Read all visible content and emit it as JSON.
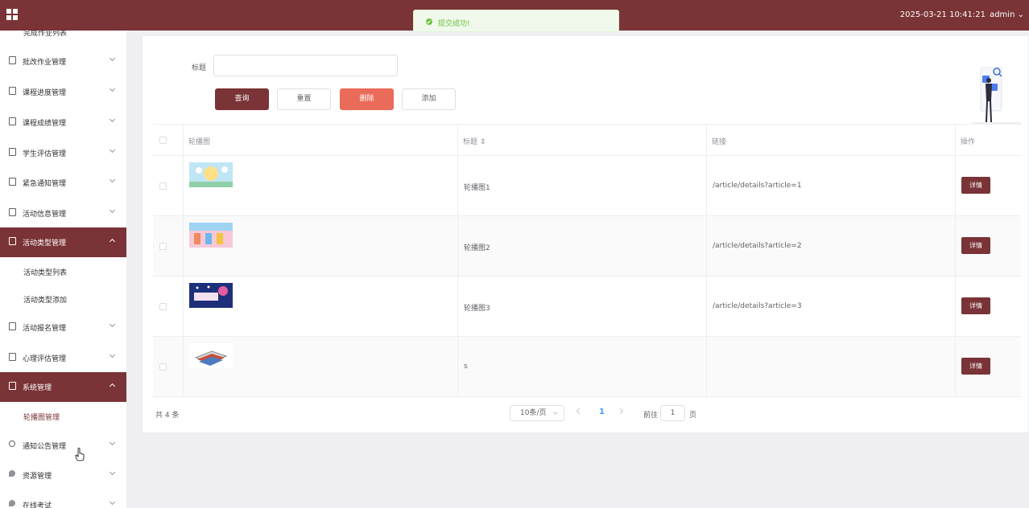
{
  "header": {
    "datetime": "2025-03-21 10:41:21",
    "user": "admin",
    "accent_color": "#7a3336"
  },
  "toast": {
    "message": "提交成功!",
    "type": "success"
  },
  "sidebar": {
    "top_cut_label": "完成作业列表",
    "items": [
      {
        "label": "批改作业管理",
        "icon": "document-icon"
      },
      {
        "label": "课程进度管理",
        "icon": "document-icon"
      },
      {
        "label": "课程成绩管理",
        "icon": "document-icon"
      },
      {
        "label": "学生评估管理",
        "icon": "document-icon"
      },
      {
        "label": "紧急通知管理",
        "icon": "document-icon"
      },
      {
        "label": "活动信息管理",
        "icon": "document-icon"
      },
      {
        "label": "活动类型管理",
        "icon": "document-icon",
        "expanded": true
      },
      {
        "label": "活动报名管理",
        "icon": "document-icon"
      },
      {
        "label": "心理评估管理",
        "icon": "document-icon"
      },
      {
        "label": "系统管理",
        "icon": "picture-icon",
        "expanded": true
      },
      {
        "label": "通知公告管理",
        "icon": "info-icon"
      },
      {
        "label": "资源管理",
        "icon": "location-icon"
      },
      {
        "label": "在线考试",
        "icon": "location-icon"
      }
    ],
    "activity_type_sub": [
      "活动类型列表",
      "活动类型添加"
    ],
    "system_sub": [
      "轮播图管理"
    ]
  },
  "search": {
    "label": "标题",
    "value": "",
    "placeholder": ""
  },
  "buttons": {
    "query": "查询",
    "reset": "重置",
    "delete": "删除",
    "add": "添加"
  },
  "table": {
    "columns": {
      "image": "轮播图",
      "title": "标题",
      "link": "链接",
      "actions": "操作"
    },
    "rows": [
      {
        "title": "轮播图1",
        "link": "/article/details?article=1",
        "action": "详情"
      },
      {
        "title": "轮播图2",
        "link": "/article/details?article=2",
        "action": "详情"
      },
      {
        "title": "轮播图3",
        "link": "/article/details?article=3",
        "action": "详情"
      },
      {
        "title": "s",
        "link": "",
        "action": "详情"
      }
    ]
  },
  "pagination": {
    "total": "共 4 条",
    "page_size": "10条/页",
    "current_page": "1",
    "goto_label": "前往",
    "goto_value": "1",
    "goto_suffix": "页"
  }
}
